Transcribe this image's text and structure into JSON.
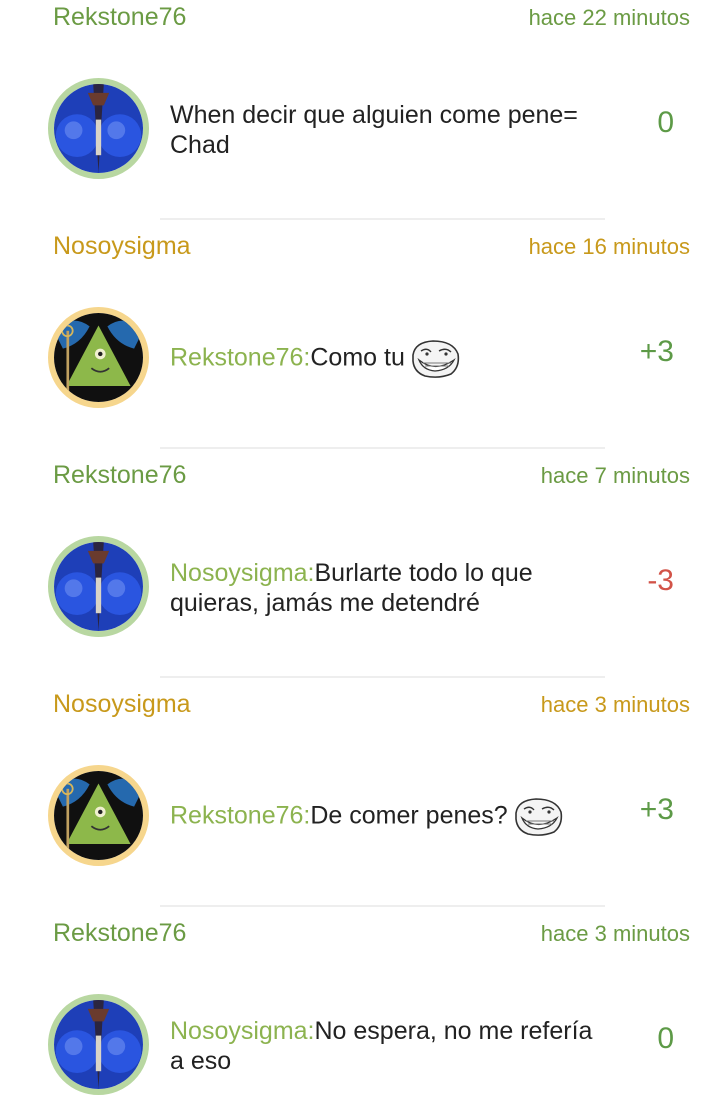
{
  "comments": [
    {
      "author": "Rekstone76",
      "time": "hace 22 minutos",
      "mention": "",
      "text": "When decir que alguien come pene= Chad",
      "score": "0",
      "troll": false
    },
    {
      "author": "Nosoysigma",
      "time": "hace 16 minutos",
      "mention": "Rekstone76:",
      "text": "Como tu",
      "score": "+3",
      "troll": true
    },
    {
      "author": "Rekstone76",
      "time": "hace 7 minutos",
      "mention": "Nosoysigma:",
      "text": "Burlarte todo lo que quieras, jamás me detendré",
      "score": "-3",
      "troll": false
    },
    {
      "author": "Nosoysigma",
      "time": "hace 3 minutos",
      "mention": "Rekstone76:",
      "text": "De comer penes?",
      "score": "+3",
      "troll": true
    },
    {
      "author": "Rekstone76",
      "time": "hace 3 minutos",
      "mention": "Nosoysigma:",
      "text": "No espera, no me refería a eso",
      "score": "0",
      "troll": false
    }
  ],
  "colors": {
    "author_green": "#6b9b44",
    "author_gold": "#c8991b",
    "mention": "#8cb34f",
    "score_positive": "#5d9a47",
    "score_negative": "#d25348"
  },
  "icons": {
    "avatar_rekstone": "blue-orb-avatar",
    "avatar_nosoysigma": "green-triangle-character-avatar",
    "emoji": "trollface-emoji"
  }
}
